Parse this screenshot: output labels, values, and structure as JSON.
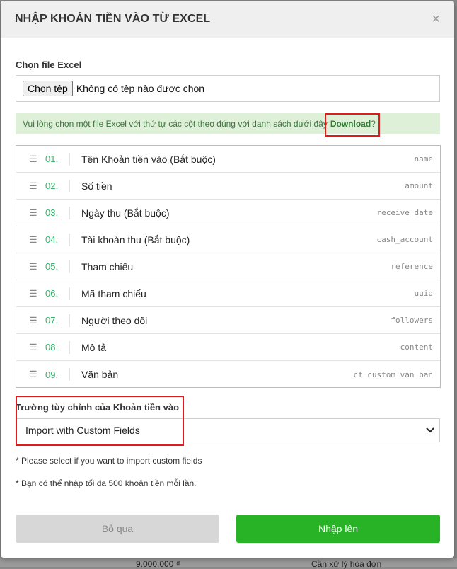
{
  "modal": {
    "title": "NHẬP KHOẢN TIỀN VÀO TỪ EXCEL",
    "close_icon": "×"
  },
  "file": {
    "label": "Chọn file Excel",
    "button": "Chọn tệp",
    "status": "Không có tệp nào được chọn"
  },
  "info": {
    "text": "Vui lòng chọn một file Excel với thứ tự các cột theo đúng với danh sách dưới đây",
    "download": "Download",
    "suffix": "?"
  },
  "columns": [
    {
      "num": "01.",
      "name": "Tên Khoản tiền vào (Bắt buộc)",
      "key": "name"
    },
    {
      "num": "02.",
      "name": "Số tiền",
      "key": "amount"
    },
    {
      "num": "03.",
      "name": "Ngày thu (Bắt buộc)",
      "key": "receive_date"
    },
    {
      "num": "04.",
      "name": "Tài khoản thu (Bắt buộc)",
      "key": "cash_account"
    },
    {
      "num": "05.",
      "name": "Tham chiếu",
      "key": "reference"
    },
    {
      "num": "06.",
      "name": "Mã tham chiếu",
      "key": "uuid"
    },
    {
      "num": "07.",
      "name": "Người theo dõi",
      "key": "followers"
    },
    {
      "num": "08.",
      "name": "Mô tả",
      "key": "content"
    },
    {
      "num": "09.",
      "name": "Văn bản",
      "key": "cf_custom_van_ban"
    }
  ],
  "custom": {
    "label": "Trường tùy chỉnh của Khoản tiền vào",
    "selected": "Import with Custom Fields"
  },
  "notes": {
    "note1": "* Please select if you want to import custom fields",
    "note2": "* Bạn có thể nhập tối đa 500 khoản tiền mỗi lần."
  },
  "buttons": {
    "skip": "Bỏ qua",
    "import": "Nhập lên"
  },
  "background": {
    "amount": "9.000.000 ₫",
    "text": "Cần xử lý hóa đơn"
  },
  "colors": {
    "accent_green": "#27b325",
    "number_green": "#38b36a",
    "highlight_red": "#e01b1b",
    "info_bg": "#dff0d8"
  }
}
